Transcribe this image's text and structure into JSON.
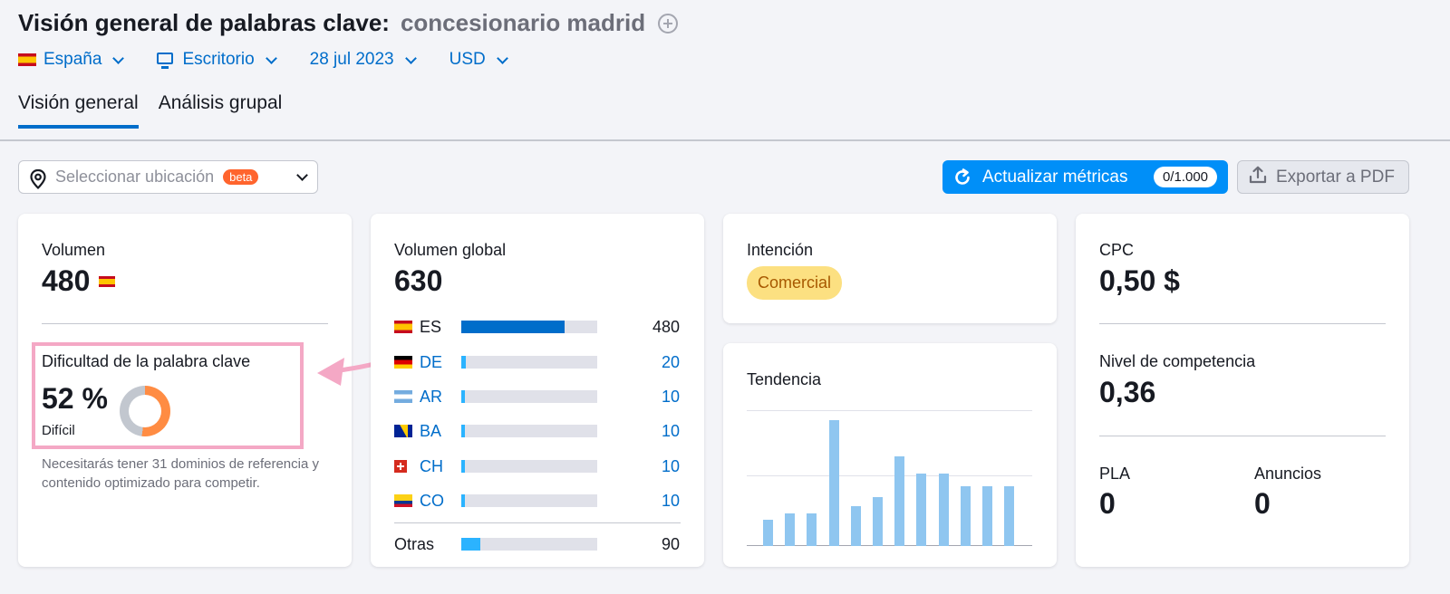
{
  "header": {
    "title": "Visión general de palabras clave:",
    "keyword": "concesionario madrid"
  },
  "filters": {
    "country": "España",
    "device": "Escritorio",
    "date": "28 jul 2023",
    "currency": "USD"
  },
  "tabs": [
    {
      "label": "Visión general",
      "active": true
    },
    {
      "label": "Análisis grupal",
      "active": false
    }
  ],
  "location_select": {
    "placeholder": "Seleccionar ubicación",
    "badge": "beta"
  },
  "toolbar": {
    "update_label": "Actualizar métricas",
    "update_counter": "0/1.000",
    "export_label": "Exportar a PDF"
  },
  "volume_card": {
    "label": "Volumen",
    "value": "480",
    "kd_label": "Dificultad de la palabra clave",
    "kd_value": "52 %",
    "kd_percent": 52,
    "kd_level": "Difícil",
    "kd_note": "Necesitarás tener 31 dominios de referencia y contenido optimizado para competir."
  },
  "global_volume_card": {
    "label": "Volumen global",
    "value": "630",
    "rows": [
      {
        "flag": "es",
        "code": "ES",
        "value": "480",
        "share": 0.76
      },
      {
        "flag": "de",
        "code": "DE",
        "value": "20",
        "share": 0.03
      },
      {
        "flag": "ar",
        "code": "AR",
        "value": "10",
        "share": 0.02
      },
      {
        "flag": "ba",
        "code": "BA",
        "value": "10",
        "share": 0.02
      },
      {
        "flag": "ch",
        "code": "CH",
        "value": "10",
        "share": 0.02
      },
      {
        "flag": "co",
        "code": "CO",
        "value": "10",
        "share": 0.02
      }
    ],
    "other": {
      "code": "Otras",
      "value": "90",
      "share": 0.14
    }
  },
  "intent_card": {
    "label": "Intención",
    "value": "Comercial"
  },
  "trend_card": {
    "label": "Tendencia",
    "values": [
      20,
      25,
      25,
      95,
      30,
      37,
      68,
      55,
      55,
      45,
      45,
      45
    ]
  },
  "cpc_card": {
    "cpc_label": "CPC",
    "cpc_value": "0,50 $",
    "competition_label": "Nivel de competencia",
    "competition_value": "0,36",
    "pla_label": "PLA",
    "pla_value": "0",
    "ads_label": "Anuncios",
    "ads_value": "0"
  }
}
